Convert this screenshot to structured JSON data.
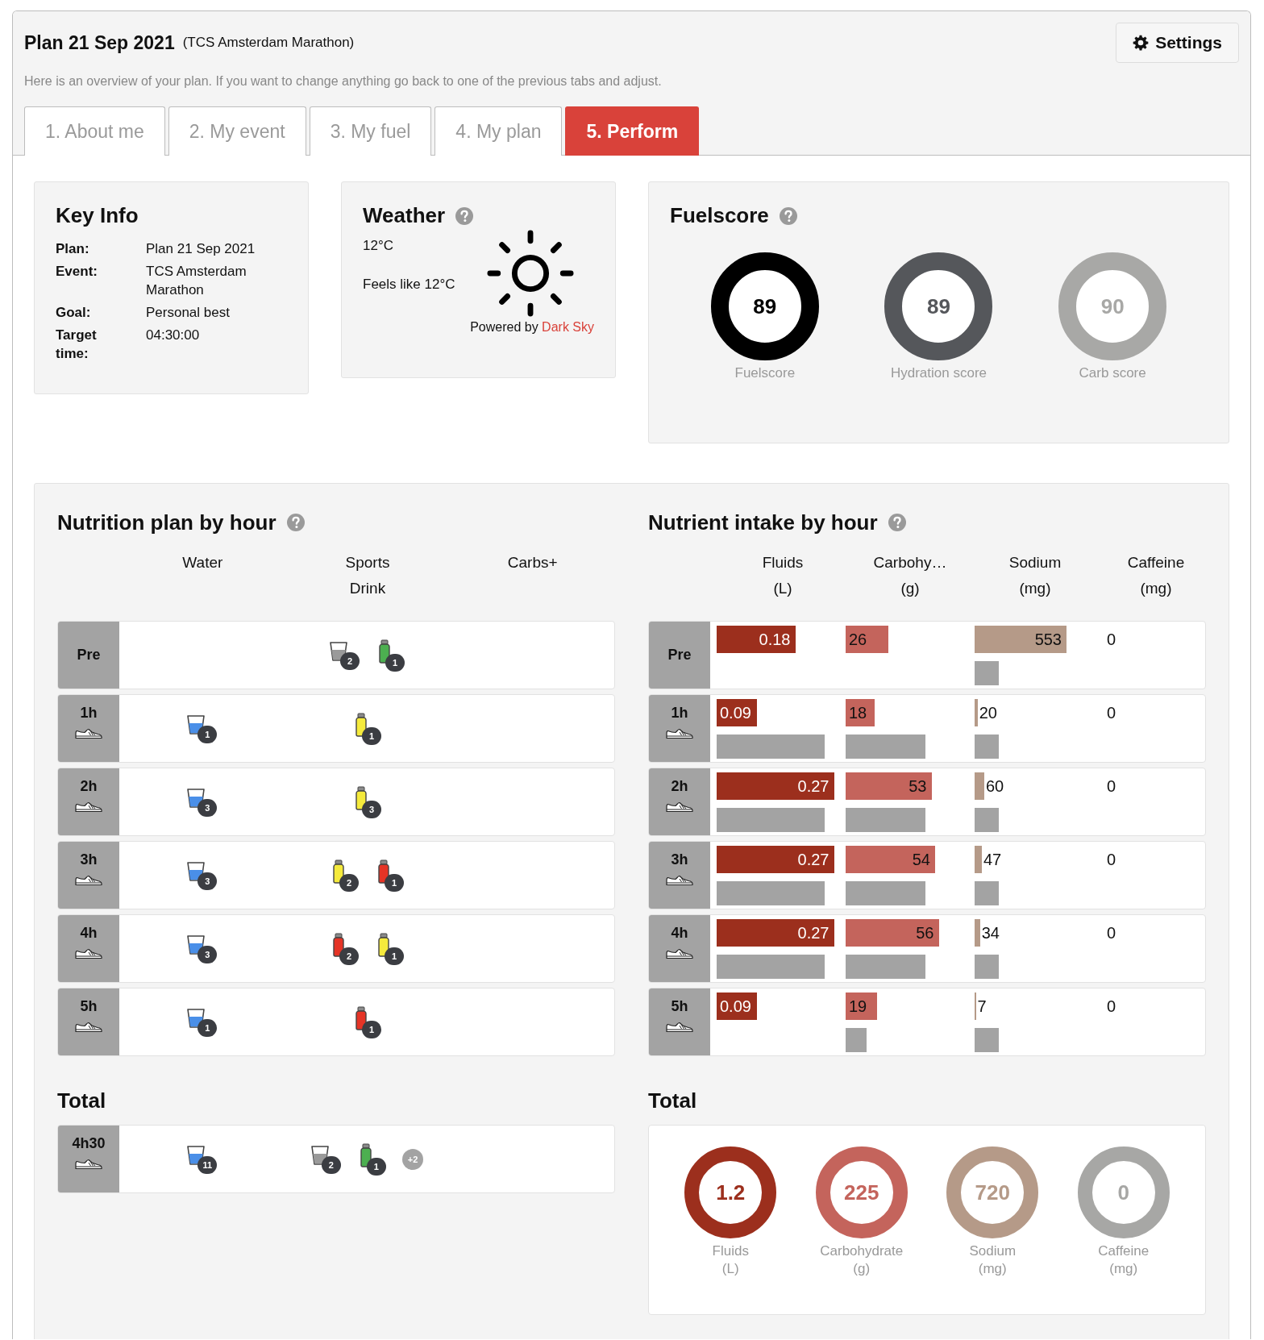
{
  "header": {
    "title": "Plan 21 Sep 2021",
    "event": "(TCS Amsterdam Marathon)",
    "subtitle": "Here is an overview of your plan. If you want to change anything go back to one of the previous tabs and adjust.",
    "settings": "Settings"
  },
  "tabs": [
    {
      "label": "1. About me",
      "selected": false
    },
    {
      "label": "2. My event",
      "selected": false
    },
    {
      "label": "3. My fuel",
      "selected": false
    },
    {
      "label": "4. My plan",
      "selected": false
    },
    {
      "label": "5. Perform",
      "selected": true
    }
  ],
  "key_info": {
    "title": "Key Info",
    "rows": [
      {
        "label": "Plan:",
        "value": "Plan 21 Sep 2021"
      },
      {
        "label": "Event:",
        "value": "TCS Amsterdam Marathon"
      },
      {
        "label": "Goal:",
        "value": "Personal best"
      },
      {
        "label": "Target time:",
        "value": "04:30:00"
      }
    ]
  },
  "weather": {
    "title": "Weather",
    "temperature": "12°C",
    "feels_like": "Feels like 12°C",
    "powered_by": "Powered by",
    "source": "Dark Sky"
  },
  "fuelscore": {
    "title": "Fuelscore",
    "scores": [
      {
        "value": "89",
        "label": "Fuelscore",
        "color": "#000000"
      },
      {
        "value": "89",
        "label": "Hydration score",
        "color": "#55575b"
      },
      {
        "value": "90",
        "label": "Carb score",
        "color": "#a8a8a6"
      }
    ]
  },
  "nutrition_plan": {
    "title": "Nutrition plan by hour",
    "columns": [
      "Water",
      "Sports Drink",
      "Carbs+"
    ],
    "rows": [
      {
        "label": "Pre",
        "kind": "pre",
        "sports_drink": [
          {
            "kind": "cup",
            "color": "#9a9a9a",
            "count": "2"
          },
          {
            "kind": "bottle",
            "color": "#4caf50",
            "count": "1"
          }
        ]
      },
      {
        "label": "1h",
        "kind": "hour",
        "water": [
          {
            "kind": "cup",
            "color": "#4a8fe8",
            "count": "1"
          }
        ],
        "sports_drink": [
          {
            "kind": "bottle",
            "color": "#f5ea3c",
            "count": "1"
          }
        ]
      },
      {
        "label": "2h",
        "kind": "hour",
        "water": [
          {
            "kind": "cup",
            "color": "#4a8fe8",
            "count": "3"
          }
        ],
        "sports_drink": [
          {
            "kind": "bottle",
            "color": "#f5ea3c",
            "count": "3"
          }
        ]
      },
      {
        "label": "3h",
        "kind": "hour",
        "water": [
          {
            "kind": "cup",
            "color": "#4a8fe8",
            "count": "3"
          }
        ],
        "sports_drink": [
          {
            "kind": "bottle",
            "color": "#f5ea3c",
            "count": "2"
          },
          {
            "kind": "bottle",
            "color": "#e53426",
            "count": "1"
          }
        ]
      },
      {
        "label": "4h",
        "kind": "hour",
        "water": [
          {
            "kind": "cup",
            "color": "#4a8fe8",
            "count": "3"
          }
        ],
        "sports_drink": [
          {
            "kind": "bottle",
            "color": "#e53426",
            "count": "2"
          },
          {
            "kind": "bottle",
            "color": "#f5ea3c",
            "count": "1"
          }
        ]
      },
      {
        "label": "5h",
        "kind": "hour",
        "water": [
          {
            "kind": "cup",
            "color": "#4a8fe8",
            "count": "1"
          }
        ],
        "sports_drink": [
          {
            "kind": "bottle",
            "color": "#e53426",
            "count": "1"
          }
        ]
      }
    ],
    "total_title": "Total",
    "total": {
      "label": "4h30",
      "kind": "hour",
      "water": [
        {
          "kind": "cup",
          "color": "#4a8fe8",
          "count": "11"
        }
      ],
      "sports_drink": [
        {
          "kind": "cup",
          "color": "#9a9a9a",
          "count": "2"
        },
        {
          "kind": "bottle",
          "color": "#4caf50",
          "count": "1"
        }
      ],
      "more": "+2"
    }
  },
  "nutrient_intake": {
    "title": "Nutrient intake by hour",
    "columns": [
      {
        "name": "Fluids",
        "unit": "(L)"
      },
      {
        "name": "Carbohy…",
        "unit": "(g)"
      },
      {
        "name": "Sodium",
        "unit": "(mg)"
      },
      {
        "name": "Caffeine",
        "unit": "(mg)"
      }
    ],
    "rows": [
      {
        "label": "Pre",
        "kind": "pre",
        "fluids": {
          "value": "0.18",
          "level": 0.65
        },
        "carbohydrate": {
          "value": "26",
          "level": 0.35
        },
        "sodium": {
          "value": "553",
          "level": 0.76,
          "target": {
            "level": 0.2
          }
        },
        "caffeine": "0"
      },
      {
        "label": "1h",
        "kind": "hour",
        "fluids": {
          "value": "0.09",
          "level": 0.33,
          "target": {
            "level": 0.89
          }
        },
        "carbohydrate": {
          "value": "18",
          "level": 0.24,
          "target": {
            "level": 0.66
          }
        },
        "sodium": {
          "value": "20",
          "level": 0.025,
          "target": {
            "level": 0.2
          }
        },
        "caffeine": "0"
      },
      {
        "label": "2h",
        "kind": "hour",
        "fluids": {
          "value": "0.27",
          "level": 0.97,
          "target": {
            "level": 0.89
          }
        },
        "carbohydrate": {
          "value": "53",
          "level": 0.71,
          "target": {
            "level": 0.66
          }
        },
        "sodium": {
          "value": "60",
          "level": 0.08,
          "target": {
            "level": 0.2
          }
        },
        "caffeine": "0"
      },
      {
        "label": "3h",
        "kind": "hour",
        "fluids": {
          "value": "0.27",
          "level": 0.97,
          "target": {
            "level": 0.89
          }
        },
        "carbohydrate": {
          "value": "54",
          "level": 0.74,
          "target": {
            "level": 0.66
          }
        },
        "sodium": {
          "value": "47",
          "level": 0.06,
          "target": {
            "level": 0.2
          }
        },
        "caffeine": "0"
      },
      {
        "label": "4h",
        "kind": "hour",
        "fluids": {
          "value": "0.27",
          "level": 0.97,
          "target": {
            "level": 0.89
          }
        },
        "carbohydrate": {
          "value": "56",
          "level": 0.77,
          "target": {
            "level": 0.66
          }
        },
        "sodium": {
          "value": "34",
          "level": 0.045,
          "target": {
            "level": 0.2
          }
        },
        "caffeine": "0"
      },
      {
        "label": "5h",
        "kind": "hour",
        "fluids": {
          "value": "0.09",
          "level": 0.33
        },
        "carbohydrate": {
          "value": "19",
          "level": 0.26,
          "target": {
            "level": 0.17
          }
        },
        "sodium": {
          "value": "7",
          "level": 0.01,
          "target": {
            "level": 0.2
          }
        },
        "caffeine": "0"
      }
    ],
    "total_title": "Total",
    "totals": [
      {
        "value": "1.2",
        "label": "Fluids",
        "unit": "(L)",
        "color": "#9c2f1d"
      },
      {
        "value": "225",
        "label": "Carbohydrate",
        "unit": "(g)",
        "color": "#c4645c"
      },
      {
        "value": "720",
        "label": "Sodium",
        "unit": "(mg)",
        "color": "#b59a88"
      },
      {
        "value": "0",
        "label": "Caffeine",
        "unit": "(mg)",
        "color": "#a7a7a5"
      }
    ]
  }
}
